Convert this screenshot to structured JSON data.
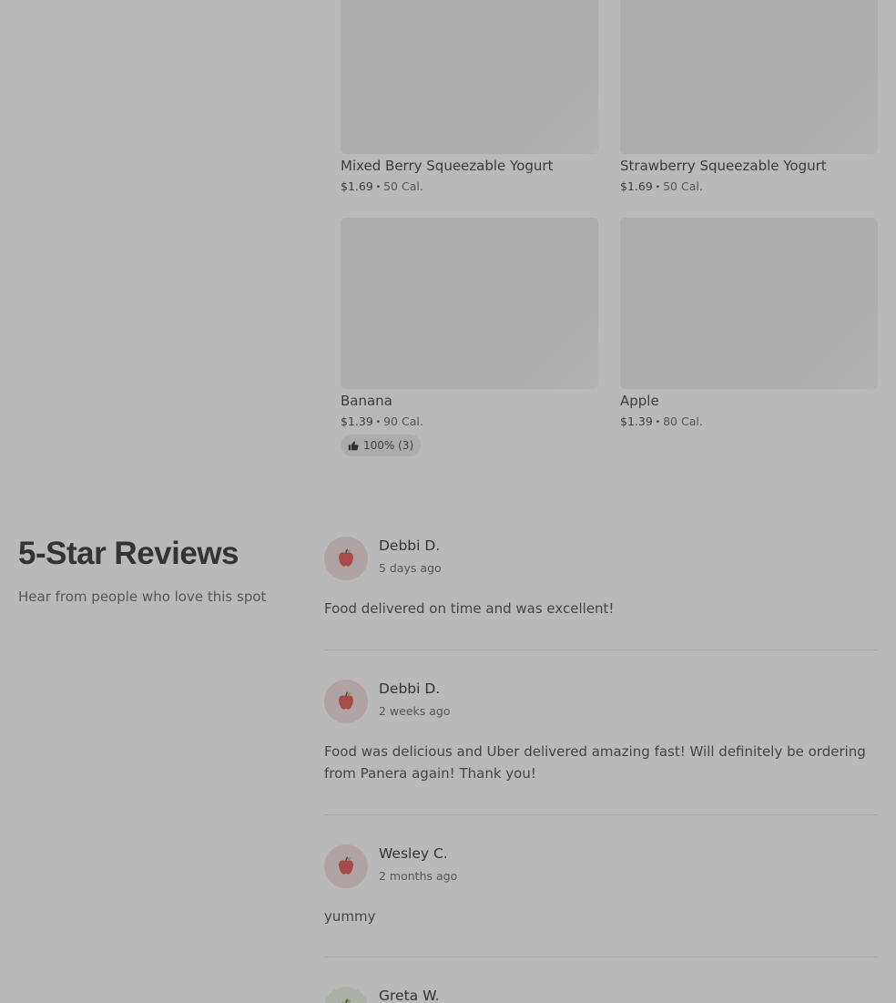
{
  "products": [
    {
      "title": "Mixed Berry Squeezable Yogurt",
      "price": "$1.69",
      "calories": "50 Cal."
    },
    {
      "title": "Strawberry Squeezable Yogurt",
      "price": "$1.69",
      "calories": "50 Cal."
    },
    {
      "title": "Banana",
      "price": "$1.39",
      "calories": "90 Cal.",
      "rating": "100% (3)"
    },
    {
      "title": "Apple",
      "price": "$1.39",
      "calories": "80 Cal."
    }
  ],
  "meta_separator": "•",
  "reviews_section": {
    "title": "5-Star Reviews",
    "subtitle": "Hear from people who love this spot"
  },
  "reviews": [
    {
      "name": "Debbi D.",
      "date": "5 days ago",
      "text": "Food delivered on time and was excellent!",
      "avatar_icon": "apple-icon"
    },
    {
      "name": "Debbi D.",
      "date": "2 weeks ago",
      "text": "Food was delicious and Uber delivered amazing fast! Will definitely be ordering from Panera again! Thank you!",
      "avatar_icon": "apple-icon"
    },
    {
      "name": "Wesley C.",
      "date": "2 months ago",
      "text": "yummy",
      "avatar_icon": "apple-icon"
    },
    {
      "name": "Greta W.",
      "avatar_icon": "apple-icon"
    }
  ],
  "colors": {
    "overlay_background": "#b9b9b9",
    "apple_red": "#a84b4b",
    "apple_green": "#6a9a5a"
  }
}
